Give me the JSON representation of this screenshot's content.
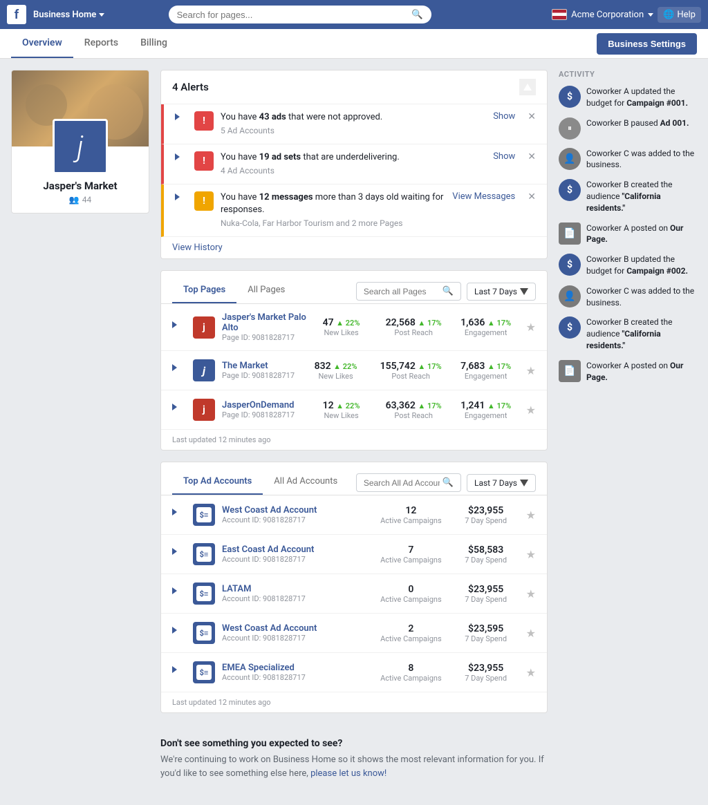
{
  "topnav": {
    "logo": "f",
    "business_home": "Business Home",
    "search_placeholder": "Search for pages...",
    "company_name": "Acme Corporation",
    "help_label": "Help"
  },
  "subnav": {
    "tabs": [
      "Overview",
      "Reports",
      "Billing"
    ],
    "active_tab": "Overview",
    "settings_button": "Business Settings"
  },
  "profile": {
    "name": "Jasper's Market",
    "followers": "44"
  },
  "alerts": {
    "title": "4 Alerts",
    "items": [
      {
        "type": "red",
        "text_start": "You have ",
        "highlight": "43 ads",
        "text_end": " that were not approved.",
        "sub": "5 Ad Accounts",
        "action": "Show"
      },
      {
        "type": "red",
        "text_start": "You have ",
        "highlight": "19 ad sets",
        "text_end": " that are underdelivering.",
        "sub": "4 Ad Accounts",
        "action": "Show"
      },
      {
        "type": "orange",
        "text_start": "You have ",
        "highlight": "12 messages",
        "text_end": " more than 3 days old waiting for responses.",
        "sub": "Nuka-Cola, Far Harbor Tourism and 2 more Pages",
        "action": "View Messages"
      }
    ],
    "view_history": "View History"
  },
  "top_pages": {
    "tabs": [
      "Top Pages",
      "All Pages"
    ],
    "active_tab": "Top Pages",
    "search_placeholder": "Search all Pages",
    "date_range": "Last 7 Days",
    "items": [
      {
        "name": "Jasper's Market Palo Alto",
        "id": "Page ID: 9081828717",
        "icon_type": "red",
        "stat1_value": "47",
        "stat1_change": "+22%",
        "stat1_label": "New Likes",
        "stat2_value": "22,568",
        "stat2_change": "+17%",
        "stat2_label": "Post Reach",
        "stat3_value": "1,636",
        "stat3_change": "+17%",
        "stat3_label": "Engagement"
      },
      {
        "name": "The Market",
        "id": "Page ID: 9081828717",
        "icon_type": "blue",
        "stat1_value": "832",
        "stat1_change": "+22%",
        "stat1_label": "New Likes",
        "stat2_value": "155,742",
        "stat2_change": "+17%",
        "stat2_label": "Post Reach",
        "stat3_value": "7,683",
        "stat3_change": "+17%",
        "stat3_label": "Engagement"
      },
      {
        "name": "JasperOnDemand",
        "id": "Page ID: 9081828717",
        "icon_type": "red",
        "stat1_value": "12",
        "stat1_change": "+22%",
        "stat1_label": "New Likes",
        "stat2_value": "63,362",
        "stat2_change": "+17%",
        "stat2_label": "Post Reach",
        "stat3_value": "1,241",
        "stat3_change": "+17%",
        "stat3_label": "Engagement"
      }
    ],
    "last_updated": "Last updated 12 minutes ago"
  },
  "top_ad_accounts": {
    "tabs": [
      "Top Ad Accounts",
      "All Ad Accounts"
    ],
    "active_tab": "Top Ad Accounts",
    "search_placeholder": "Search All Ad Accounts",
    "date_range": "Last 7 Days",
    "items": [
      {
        "name": "West Coast Ad Account",
        "id": "Account ID: 9081828717",
        "stat1_value": "12",
        "stat1_label": "Active Campaigns",
        "stat2_value": "$23,955",
        "stat2_label": "7 Day Spend"
      },
      {
        "name": "East Coast Ad Account",
        "id": "Account ID: 9081828717",
        "stat1_value": "7",
        "stat1_label": "Active Campaigns",
        "stat2_value": "$58,583",
        "stat2_label": "7 Day Spend"
      },
      {
        "name": "LATAM",
        "id": "Account ID: 9081828717",
        "stat1_value": "0",
        "stat1_label": "Active Campaigns",
        "stat2_value": "$23,955",
        "stat2_label": "7 Day Spend"
      },
      {
        "name": "West Coast Ad Account",
        "id": "Account ID: 9081828717",
        "stat1_value": "2",
        "stat1_label": "Active Campaigns",
        "stat2_value": "$23,595",
        "stat2_label": "7 Day Spend"
      },
      {
        "name": "EMEA Specialized",
        "id": "Account ID: 9081828717",
        "stat1_value": "8",
        "stat1_label": "Active Campaigns",
        "stat2_value": "$23,955",
        "stat2_label": "7 Day Spend"
      }
    ],
    "last_updated": "Last updated 12 minutes ago"
  },
  "bottom_note": {
    "title": "Don't see something you expected to see?",
    "text": "We're continuing to work on Business Home so it shows the most relevant information for you. If you'd like to see something else here,",
    "link": "please let us know!"
  },
  "activity": {
    "title": "ACTIVITY",
    "items": [
      {
        "avatar_color": "#3b5998",
        "avatar_type": "dollar",
        "text": "Coworker A updated the budget for ",
        "highlight": "Campaign #001."
      },
      {
        "avatar_color": "#8a8a8a",
        "avatar_type": "pause",
        "text": "Coworker B paused ",
        "highlight": "Ad 001."
      },
      {
        "avatar_color": "#7a7a7a",
        "avatar_type": "person",
        "text": "Coworker C was added to the business."
      },
      {
        "avatar_color": "#3b5998",
        "avatar_type": "dollar",
        "text": "Coworker B created the audience ",
        "highlight": "\"California residents.\""
      },
      {
        "avatar_color": "#7a7a7a",
        "avatar_type": "doc",
        "text": "Coworker A posted on ",
        "highlight": "Our Page."
      },
      {
        "avatar_color": "#3b5998",
        "avatar_type": "dollar",
        "text": "Coworker B updated the budget for ",
        "highlight": "Campaign #002."
      },
      {
        "avatar_color": "#7a7a7a",
        "avatar_type": "person",
        "text": "Coworker C was added to the business."
      },
      {
        "avatar_color": "#3b5998",
        "avatar_type": "dollar",
        "text": "Coworker B created the audience ",
        "highlight": "\"California residents.\""
      },
      {
        "avatar_color": "#7a7a7a",
        "avatar_type": "doc",
        "text": "Coworker A posted on ",
        "highlight": "Our Page."
      }
    ]
  }
}
